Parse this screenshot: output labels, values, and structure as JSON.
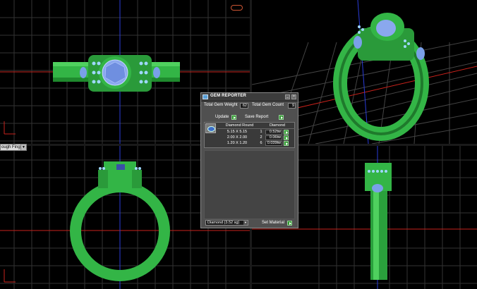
{
  "viewports": {
    "view_mode": "ough Finger",
    "colors": {
      "background": "#000000",
      "grid_minor": "#3a3a3a",
      "grid_major": "#6a6a6a",
      "axis_red": "#c8221b",
      "axis_blue": "#2a3cd8",
      "ring_green": "#33b546",
      "ring_dark": "#1f7a2c",
      "gem_blue": "#7fa0e8",
      "accent_gems": "#9fd8ff"
    },
    "icons": [
      "top-view-icon",
      "perspective-view-icon",
      "front-view-icon",
      "side-view-icon",
      "ring-preview-icon"
    ]
  },
  "gem_reporter": {
    "title": "GEM REPORTER",
    "total_weight_label": "Total Gem Weight",
    "total_weight_value": "62",
    "total_count_label": "Total Gem Count",
    "total_count_value": "9",
    "update_label": "Update",
    "save_report_label": "Save Report",
    "table": {
      "headers": [
        "Diamond Round",
        "Diamond"
      ],
      "rows": [
        {
          "size": "5.15 X 5.15",
          "count": "1",
          "weight": "0.52tw"
        },
        {
          "size": "2.00 X 2.00",
          "count": "2",
          "weight": "0.06tw"
        },
        {
          "size": "1.20 X 1.20",
          "count": "6",
          "weight": "0.039tw"
        }
      ]
    },
    "material_value": "Diamond   (3.52 sg)",
    "set_material_label": "Set Material"
  }
}
